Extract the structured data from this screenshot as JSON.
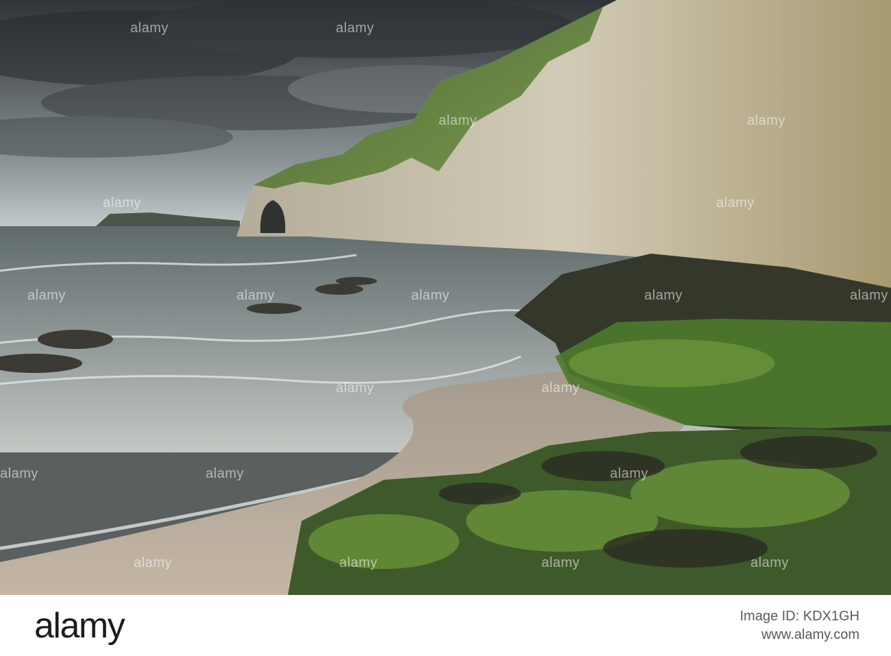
{
  "photo": {
    "alt": "Chalk cliffs with sea arch above a sandy beach, waves washing over weed-covered rocks under a stormy sky",
    "sky_color": "#3f4446",
    "sea_color": "#9aa1a0",
    "sand_color": "#b7a999",
    "cliff_color": "#c9c2ad",
    "grass_color": "#4f7a32"
  },
  "watermark": {
    "text": "alamy",
    "repeats": 18
  },
  "footer": {
    "logo": "alamy",
    "image_id_label": "Image ID: KDX1GH",
    "site": "www.alamy.com"
  }
}
